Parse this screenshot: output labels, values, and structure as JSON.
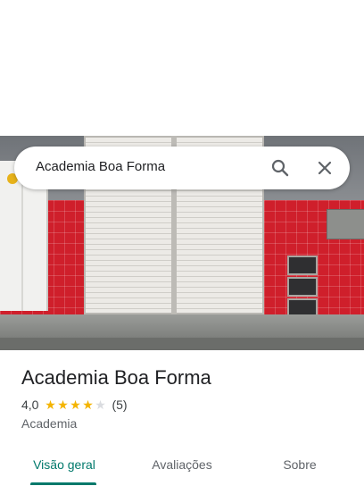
{
  "search": {
    "query": "Academia Boa Forma"
  },
  "place": {
    "name": "Academia Boa Forma",
    "rating": "4,0",
    "rating_value": 4.0,
    "stars_max": 5,
    "reviews": "(5)",
    "category": "Academia"
  },
  "tabs": [
    {
      "label": "Visão geral",
      "selected": true
    },
    {
      "label": "Avaliações",
      "selected": false
    },
    {
      "label": "Sobre",
      "selected": false
    }
  ],
  "colors": {
    "accent": "#00796b",
    "star": "#f4b400",
    "storefront_red": "#cf1f2b"
  },
  "icons": {
    "search": "search-icon",
    "close": "close-icon"
  }
}
